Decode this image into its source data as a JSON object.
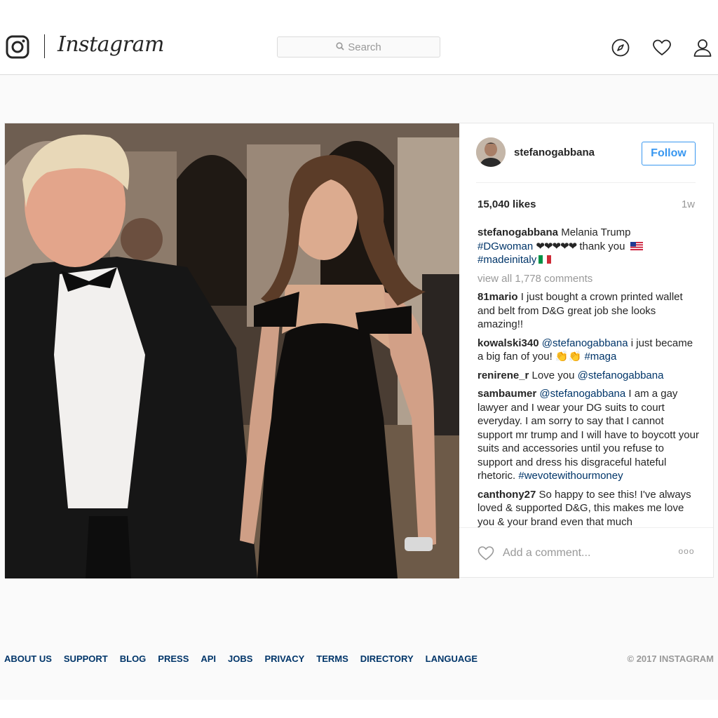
{
  "header": {
    "wordmark": "Instagram",
    "search_placeholder": "Search",
    "icons": [
      "instagram-logo-icon",
      "compass-icon",
      "heart-icon",
      "profile-icon"
    ]
  },
  "post": {
    "author": "stefanogabbana",
    "follow_label": "Follow",
    "likes": "15,040 likes",
    "age": "1w",
    "caption": {
      "user": "stefanogabbana",
      "text": "Melania Trump",
      "tag1": "#DGwoman",
      "hearts": "❤❤❤❤❤",
      "thanks": "thank you",
      "tag2": "#madeinitaly"
    },
    "view_all": "view all 1,778 comments",
    "comments": [
      {
        "user": "81mario",
        "text": "I just bought a crown printed wallet and belt from D&G great job she looks amazing!!"
      },
      {
        "user": "kowalski340",
        "mention": "@stefanogabbana",
        "text": "i just became a big fan of you!",
        "emoji": "👏👏",
        "tag": "#maga"
      },
      {
        "user": "renirene_r",
        "text": "Love you",
        "mention": "@stefanogabbana"
      },
      {
        "user": "sambaumer",
        "mention": "@stefanogabbana",
        "text": "I am a gay lawyer and I wear your DG suits to court everyday. I am sorry to say that I cannot support mr trump and I will have to boycott your suits and accessories until you refuse to support and dress his disgraceful hateful rhetoric.",
        "tag": "#wevotewithourmoney"
      },
      {
        "user": "canthony27",
        "text": "So happy to see this! I've always loved & supported D&G, this makes me love you & your brand even that much"
      }
    ],
    "add_comment_placeholder": "Add a comment...",
    "more_label": "ooo"
  },
  "footer": {
    "links": [
      "ABOUT US",
      "SUPPORT",
      "BLOG",
      "PRESS",
      "API",
      "JOBS",
      "PRIVACY",
      "TERMS",
      "DIRECTORY",
      "LANGUAGE"
    ],
    "copyright": "© 2017 INSTAGRAM"
  },
  "colors": {
    "link_blue": "#003569",
    "follow_blue": "#3897f0",
    "muted": "#999999",
    "border": "#dbdbdb",
    "background": "#fafafa"
  }
}
